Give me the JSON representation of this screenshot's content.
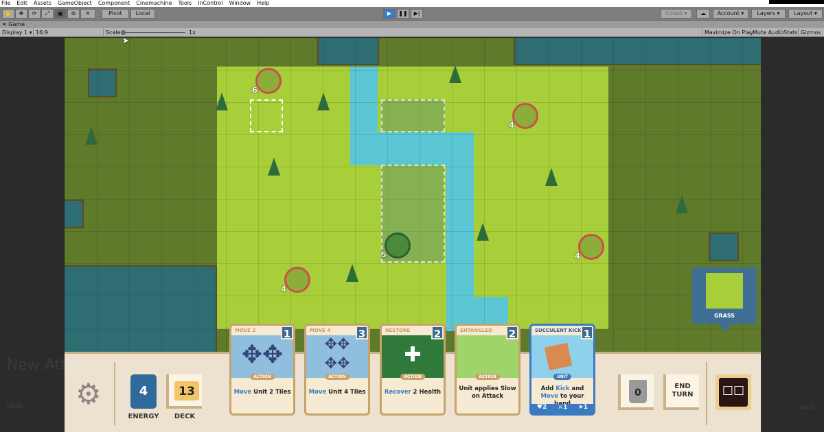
{
  "menu": [
    "File",
    "Edit",
    "Assets",
    "GameObject",
    "Component",
    "Cinemachine",
    "Tools",
    "InControl",
    "Window",
    "Help"
  ],
  "toolbar": {
    "pivot": "Pivot",
    "local": "Local",
    "collab": "Collab",
    "account": "Account",
    "layers": "Layers",
    "layout": "Layout"
  },
  "game_tab": {
    "label": "Game",
    "display": "Display 1",
    "aspect": "16:9",
    "scale_label": "Scale",
    "scale_value": "1x",
    "maximize": "Maximize On Play",
    "mute": "Mute Audio",
    "stats": "Stats",
    "gizmos": "Gizmos"
  },
  "video_overlay": {
    "title": "New Atta",
    "time_start": "00:00",
    "time_end": "00:21"
  },
  "units": [
    {
      "hp": "6",
      "side": "enemy"
    },
    {
      "hp": "4",
      "side": "enemy"
    },
    {
      "hp": "5",
      "side": "ally"
    },
    {
      "hp": "4",
      "side": "enemy"
    },
    {
      "hp": "4",
      "side": "enemy"
    }
  ],
  "tile_info": {
    "label": "GRASS"
  },
  "hud": {
    "energy_value": "4",
    "energy_label": "ENERGY",
    "deck_value": "13",
    "deck_label": "DECK",
    "discard_value": "0",
    "end_turn": "END TURN"
  },
  "cards": [
    {
      "title": "MOVE 2",
      "cost": "1",
      "tag": "ACTION",
      "desc_kw": "Move",
      "desc": " Unit 2 Tiles"
    },
    {
      "title": "MOVE 4",
      "cost": "3",
      "tag": "ACTION",
      "desc_kw": "Move",
      "desc": " Unit 4 Tiles"
    },
    {
      "title": "RESTORE",
      "cost": "2",
      "tag": "ACTION",
      "desc_kw": "Recover",
      "desc": " 2 Health"
    },
    {
      "title": "ENTANGLED",
      "cost": "2",
      "tag": "ACTION",
      "desc": "Unit applies Slow on Attack"
    },
    {
      "title": "SUCCULENT KICKER",
      "cost": "1",
      "tag": "UNIT",
      "desc_a": "Add ",
      "desc_kw1": "Kick",
      "desc_b": " and ",
      "desc_kw2": "Move",
      "desc_c": " to your hand",
      "health": "2",
      "attack": "1",
      "move": "1"
    }
  ],
  "colors": {
    "accent": "#3a7ac0",
    "card_border": "#c7a36a",
    "bright_grass": "#a8cf3a",
    "dark_grass": "#5f7a2a",
    "river": "#5bc6d4",
    "energy": "#2f6a9a",
    "deck": "#f3c56a"
  }
}
